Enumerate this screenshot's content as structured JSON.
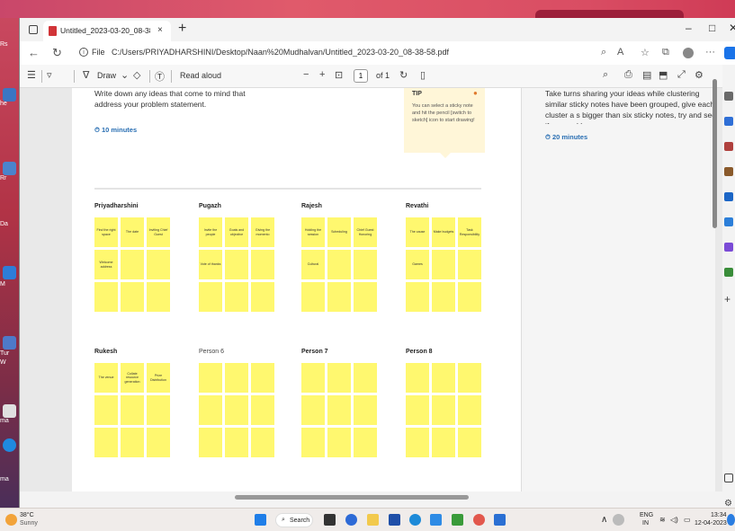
{
  "desktop": {
    "labels": [
      "Rs",
      "he",
      "Rr",
      "Da",
      "M",
      "Tur",
      "W",
      "ma",
      "ma"
    ]
  },
  "browser": {
    "tab_title": "Untitled_2023-03-20_08-38-58.p",
    "new_tab": "+",
    "close_tab": "×",
    "window_controls": [
      "–",
      "□",
      "✕"
    ],
    "url_label": "File",
    "url": "C:/Users/PRIYADHARSHINI/Desktop/Naan%20Mudhalvan/Untitled_2023-03-20_08-38-58.pdf"
  },
  "pdf_toolbar": {
    "draw_label": "Draw",
    "read_aloud_label": "Read aloud",
    "zoom_out": "−",
    "zoom_in": "+",
    "page_number": "1",
    "page_total": "of 1"
  },
  "page": {
    "left_instruction": "Write down any ideas that come to mind that address your problem statement.",
    "left_timer": "10 minutes",
    "tip_title": "TIP",
    "tip_text": "You can select a sticky note and hit the pencil [switch to sketch] icon to start drawing!",
    "right_instruction": "Take turns sharing your ideas while clustering similar sticky notes have been grouped, give each cluster a s bigger than six sticky notes, try and see if you and bre",
    "right_timer": "20 minutes",
    "persons": [
      {
        "name": "Priyadharshini",
        "bold": true,
        "notes": [
          "Find the right space",
          "The date",
          "Inviting Chief Guest",
          "Welcome address",
          "",
          "",
          "",
          "",
          ""
        ]
      },
      {
        "name": "Pugazh",
        "bold": true,
        "notes": [
          "Invite the people",
          "Goals and objective",
          "Giving the momento",
          "Vote of thanks",
          "",
          "",
          "",
          "",
          ""
        ]
      },
      {
        "name": "Rajesh",
        "bold": true,
        "notes": [
          "Holding the session",
          "Scheduling",
          "Chief Guest Honoring",
          "Cultural",
          "",
          "",
          "",
          "",
          ""
        ]
      },
      {
        "name": "Revathi",
        "bold": true,
        "notes": [
          "The cause",
          "Make budgets",
          "Task Responsibility",
          "Games",
          "",
          "",
          "",
          "",
          ""
        ]
      },
      {
        "name": "Rukesh",
        "bold": true,
        "notes": [
          "The venue",
          "Collate resource generation",
          "Prize Distribution",
          "",
          "",
          "",
          "",
          "",
          ""
        ]
      },
      {
        "name": "Person 6",
        "bold": false,
        "notes": [
          "",
          "",
          "",
          "",
          "",
          "",
          "",
          "",
          ""
        ]
      },
      {
        "name": "Person 7",
        "bold": true,
        "notes": [
          "",
          "",
          "",
          "",
          "",
          "",
          "",
          "",
          ""
        ]
      },
      {
        "name": "Person 8",
        "bold": true,
        "notes": [
          "",
          "",
          "",
          "",
          "",
          "",
          "",
          "",
          ""
        ]
      }
    ]
  },
  "taskbar": {
    "weather_temp": "38°C",
    "weather_desc": "Sunny",
    "search_label": "Search",
    "lang": "ENG",
    "lang_region": "IN",
    "time": "13:34",
    "date": "12-04-2023"
  },
  "colors": {
    "sticky_note": "#fff86f",
    "accent_blue": "#2a6fb3"
  }
}
